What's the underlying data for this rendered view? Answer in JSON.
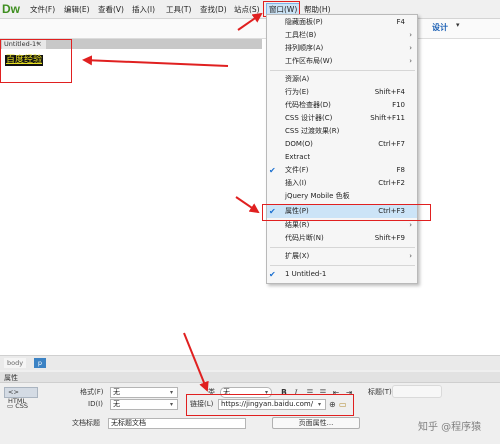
{
  "app": {
    "logo": "Dw"
  },
  "menubar": [
    {
      "label": "文件(F)"
    },
    {
      "label": "编辑(E)"
    },
    {
      "label": "查看(V)"
    },
    {
      "label": "插入(I)"
    },
    {
      "label": "工具(T)"
    },
    {
      "label": "查找(D)"
    },
    {
      "label": "站点(S)"
    },
    {
      "label": "窗口(W)",
      "active": true
    },
    {
      "label": "帮助(H)"
    }
  ],
  "toolbar": {
    "view_mode": "设计",
    "caret": "▾"
  },
  "document": {
    "tab_label": "Untitled-1*",
    "close": "×",
    "content_text": "百度经验"
  },
  "window_menu": [
    {
      "label": "隐藏面板(P)",
      "shortcut": "F4"
    },
    {
      "label": "工具栏(B)",
      "submenu": true
    },
    {
      "label": "排列顺序(A)",
      "submenu": true
    },
    {
      "label": "工作区布局(W)",
      "submenu": true
    },
    {
      "separator": true
    },
    {
      "label": "资源(A)"
    },
    {
      "label": "行为(E)",
      "shortcut": "Shift+F4"
    },
    {
      "label": "代码检查器(D)",
      "shortcut": "F10"
    },
    {
      "label": "CSS 设计器(C)",
      "shortcut": "Shift+F11"
    },
    {
      "label": "CSS 过渡效果(R)"
    },
    {
      "label": "DOM(O)",
      "shortcut": "Ctrl+F7"
    },
    {
      "label": "Extract"
    },
    {
      "label": "文件(F)",
      "shortcut": "F8",
      "checked": true
    },
    {
      "label": "插入(I)",
      "shortcut": "Ctrl+F2"
    },
    {
      "label": "jQuery Mobile 色板"
    },
    {
      "label": "属性(P)",
      "shortcut": "Ctrl+F3",
      "checked": true,
      "highlighted": true
    },
    {
      "label": "结果(R)",
      "submenu": true
    },
    {
      "label": "代码片断(N)",
      "shortcut": "Shift+F9"
    },
    {
      "separator": true
    },
    {
      "label": "扩展(X)",
      "submenu": true
    },
    {
      "separator": true
    },
    {
      "label": "1 Untitled-1",
      "checked": true
    }
  ],
  "statusbar": {
    "crumb_body": "body",
    "crumb_p": "p"
  },
  "properties": {
    "title": "属性",
    "html_button": "HTML",
    "css_button": "CSS",
    "format_label": "格式(F)",
    "format_value": "无",
    "id_label": "ID(I)",
    "id_value": "无",
    "class_label": "类",
    "class_value": "无",
    "link_label": "链接(L)",
    "link_value": "https://jingyan.baidu.com/",
    "title_label": "标题(T)",
    "doc_title_label": "文档标题",
    "doc_title_value": "无标题文档",
    "page_props_button": "页面属性...",
    "bold": "B",
    "italic": "I",
    "list_ul": "☰",
    "list_ol": "☰",
    "outdent": "⇤",
    "indent": "⇥"
  },
  "watermark": "知乎 @程序猿",
  "annotation_color": "#e02020"
}
